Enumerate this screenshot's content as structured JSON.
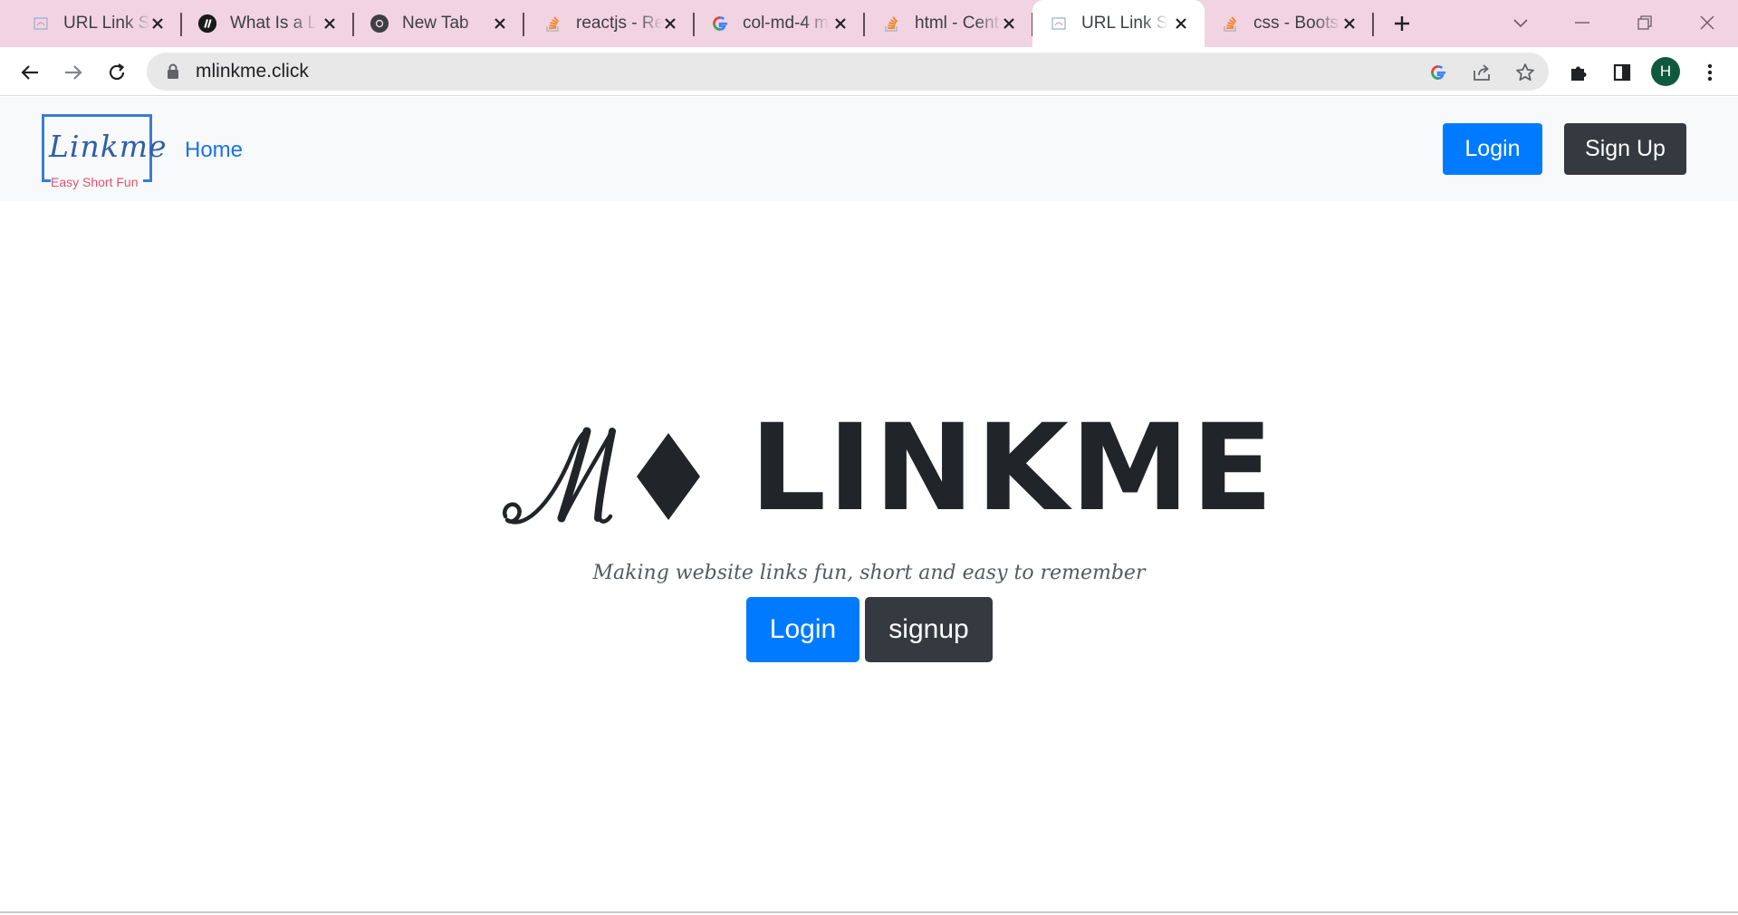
{
  "browser": {
    "tabs": [
      {
        "title": "URL Link Sh",
        "icon": "linkme-favicon",
        "active": false
      },
      {
        "title": "What Is a La",
        "icon": "blog-favicon",
        "active": false
      },
      {
        "title": "New Tab",
        "icon": "chrome-icon",
        "active": false
      },
      {
        "title": "reactjs - Re",
        "icon": "stackoverflow-icon",
        "active": false
      },
      {
        "title": "col-md-4 m",
        "icon": "google-icon",
        "active": false
      },
      {
        "title": "html - Cent",
        "icon": "stackoverflow-icon",
        "active": false
      },
      {
        "title": "URL Link Sh",
        "icon": "linkme-favicon",
        "active": true
      },
      {
        "title": "css - Boots",
        "icon": "stackoverflow-icon",
        "active": false
      }
    ],
    "url": "mlinkme.click",
    "profile_initial": "H",
    "colors": {
      "tabstrip": "#f2d3e2",
      "profile": "#0f5a3e"
    }
  },
  "site": {
    "brand": {
      "script": "Linkme",
      "tagline": "Easy Short Fun"
    },
    "nav": {
      "home": "Home",
      "login": "Login",
      "signup": "Sign Up"
    },
    "hero": {
      "monogram": "M",
      "wordmark": "LINKME",
      "tagline": "Making website links fun, short and easy to remember",
      "login": "Login",
      "signup": "signup"
    },
    "colors": {
      "primary": "#007bff",
      "dark": "#343a40",
      "navbar_bg": "#f8f9fa",
      "text": "#212529"
    }
  }
}
